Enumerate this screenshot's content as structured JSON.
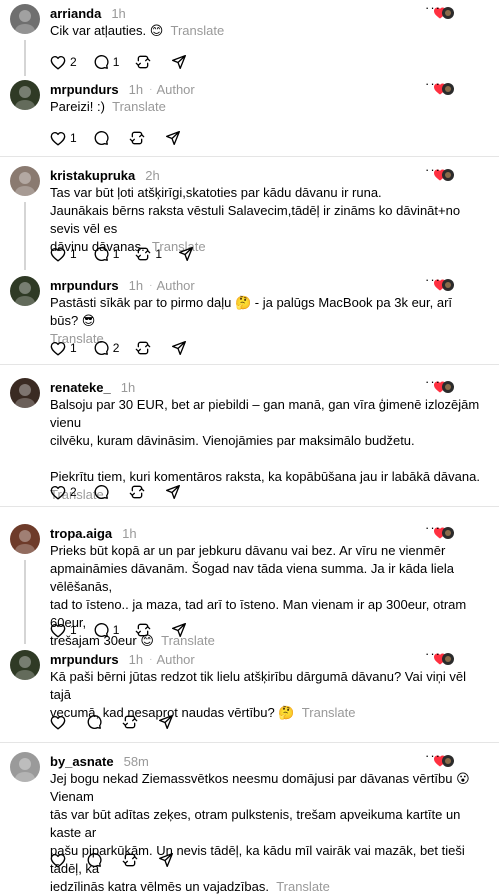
{
  "posts": [
    {
      "username": "arrianda",
      "time": "1h",
      "author": "",
      "lines": [
        "Cik var atļauties. 😊"
      ],
      "translate": "Translate",
      "likes": "2",
      "replies": "1",
      "reposts": "",
      "avatar_color": "#6f6f6f"
    },
    {
      "username": "mrpundurs",
      "time": "1h",
      "author": "Author",
      "lines": [
        "Pareizi! :)"
      ],
      "translate": "Translate",
      "likes": "1",
      "replies": "",
      "reposts": "",
      "avatar_color": "#2f3a25"
    },
    {
      "username": "kristakupruka",
      "time": "2h",
      "author": "",
      "lines": [
        "Tas var būt ļoti atšķirīgi,skatoties par kādu dāvanu ir runa.",
        "Jaunākais bērns raksta vēstuli Salavecim,tādēļ ir zināms ko dāvināt+no sevis vēl es",
        "dāvinu dāvanas."
      ],
      "translate": "Translate",
      "likes": "1",
      "replies": "1",
      "reposts": "1",
      "avatar_color": "#8a7a70"
    },
    {
      "username": "mrpundurs",
      "time": "1h",
      "author": "Author",
      "lines": [
        "Pastāsti sīkāk par to pirmo daļu 🤔 - ja palūgs MacBook pa 3k eur, arī būs? 😎"
      ],
      "translate": "Translate",
      "likes": "1",
      "replies": "2",
      "reposts": "",
      "avatar_color": "#2f3a25"
    },
    {
      "username": "renateke_",
      "time": "1h",
      "author": "",
      "lines": [
        "Balsoju par 30 EUR, bet ar piebildi – gan manā, gan vīra ģimenē izlozējām vienu",
        "cilvēku, kuram dāvināsim. Vienojāmies par maksimālo budžetu.",
        "",
        "Piekrītu tiem, kuri komentāros raksta, ka kopābūšana jau ir labākā dāvana."
      ],
      "translate": "Translate",
      "likes": "2",
      "replies": "",
      "reposts": "",
      "avatar_color": "#3a2a22"
    },
    {
      "username": "tropa.aiga",
      "time": "1h",
      "author": "",
      "lines": [
        "Prieks būt kopā ar un par jebkuru dāvanu vai bez. Ar vīru ne vienmēr",
        "apmaināmies dāvanām. Šogad nav tāda viena summa. Ja ir kāda liela vēlēšanās,",
        "tad to īsteno.. ja maza, tad arī to īsteno. Man vienam ir ap 300eur, otram 60eur,",
        "trešajam 30eur 😊"
      ],
      "translate": "Translate",
      "likes": "1",
      "replies": "1",
      "reposts": "",
      "avatar_color": "#6e3b2a"
    },
    {
      "username": "mrpundurs",
      "time": "1h",
      "author": "Author",
      "lines": [
        "Kā paši bērni jūtas redzot tik lielu atšķirību dārgumā dāvanu? Vai viņi vēl tajā",
        "vecumā, kad nesaprot naudas vērtību? 🤔"
      ],
      "translate": "Translate",
      "likes": "",
      "replies": "",
      "reposts": "",
      "avatar_color": "#2f3a25"
    },
    {
      "username": "by_asnate",
      "time": "58m",
      "author": "",
      "lines": [
        "Jej bogu nekad Ziemassvētkos neesmu domājusi par dāvanas vērtību 😮 Vienam",
        "tās var būt adītas zeķes, otram pulkstenis, trešam apveikuma kartīte un kaste ar",
        "pašu piparkūkām. Un nevis tādēļ, ka kādu mīl vairāk vai mazāk, bet tieši tādēļ, ka",
        "iedzīlinās katra vēlmēs un vajadzības."
      ],
      "translate": "Translate",
      "likes": "",
      "replies": "",
      "reposts": "",
      "avatar_color": "#9a9a9a"
    }
  ],
  "colors": {
    "muted": "#999999",
    "like_red": "#ff3040",
    "divider": "#e5e5e5"
  }
}
